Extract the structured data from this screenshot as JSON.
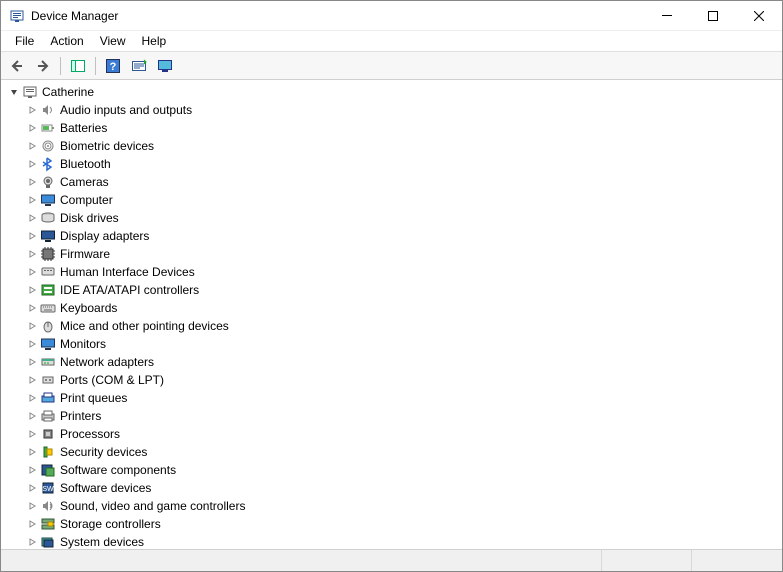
{
  "window": {
    "title": "Device Manager"
  },
  "menu": {
    "file": "File",
    "action": "Action",
    "view": "View",
    "help": "Help"
  },
  "toolbar_icons": {
    "back": "back-arrow",
    "forward": "forward-arrow",
    "show_hide": "show-hide-console-tree",
    "help": "help",
    "scan": "scan-hardware",
    "monitor": "devices-view"
  },
  "tree": {
    "root": {
      "label": "Catherine",
      "expanded": true
    },
    "children": [
      {
        "label": "Audio inputs and outputs",
        "icon": "speaker"
      },
      {
        "label": "Batteries",
        "icon": "battery"
      },
      {
        "label": "Biometric devices",
        "icon": "fingerprint"
      },
      {
        "label": "Bluetooth",
        "icon": "bluetooth"
      },
      {
        "label": "Cameras",
        "icon": "camera"
      },
      {
        "label": "Computer",
        "icon": "monitor"
      },
      {
        "label": "Disk drives",
        "icon": "disk"
      },
      {
        "label": "Display adapters",
        "icon": "display"
      },
      {
        "label": "Firmware",
        "icon": "chip"
      },
      {
        "label": "Human Interface Devices",
        "icon": "hid"
      },
      {
        "label": "IDE ATA/ATAPI controllers",
        "icon": "ide"
      },
      {
        "label": "Keyboards",
        "icon": "keyboard"
      },
      {
        "label": "Mice and other pointing devices",
        "icon": "mouse"
      },
      {
        "label": "Monitors",
        "icon": "monitor"
      },
      {
        "label": "Network adapters",
        "icon": "network"
      },
      {
        "label": "Ports (COM & LPT)",
        "icon": "port"
      },
      {
        "label": "Print queues",
        "icon": "printqueue"
      },
      {
        "label": "Printers",
        "icon": "printer"
      },
      {
        "label": "Processors",
        "icon": "cpu"
      },
      {
        "label": "Security devices",
        "icon": "security"
      },
      {
        "label": "Software components",
        "icon": "swcomp"
      },
      {
        "label": "Software devices",
        "icon": "swdev"
      },
      {
        "label": "Sound, video and game controllers",
        "icon": "sound"
      },
      {
        "label": "Storage controllers",
        "icon": "storage"
      },
      {
        "label": "System devices",
        "icon": "system"
      }
    ]
  }
}
